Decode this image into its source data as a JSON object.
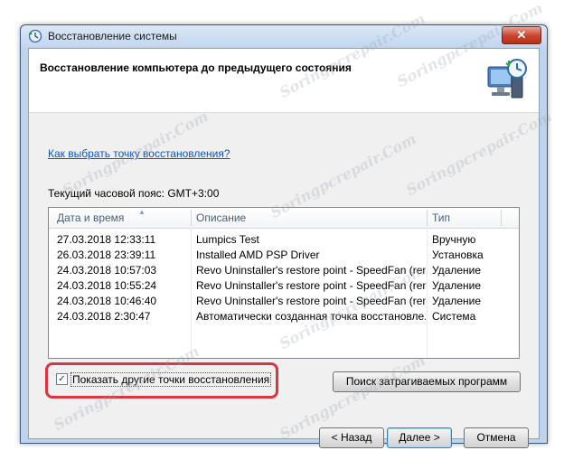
{
  "window": {
    "title": "Восстановление системы",
    "close_label": "✕"
  },
  "header": {
    "title": "Восстановление компьютера до предыдущего состояния"
  },
  "help_link": "Как выбрать точку восстановления?",
  "timezone": "Текущий часовой пояс: GMT+3:00",
  "table": {
    "columns": [
      "Дата и время",
      "Описание",
      "Тип"
    ],
    "rows": [
      {
        "date": "27.03.2018 12:33:11",
        "desc": "Lumpics Test",
        "type": "Вручную"
      },
      {
        "date": "26.03.2018 23:39:11",
        "desc": "Installed AMD PSP Driver",
        "type": "Установка"
      },
      {
        "date": "24.03.2018 10:57:03",
        "desc": "Revo Uninstaller's restore point - SpeedFan (rem...",
        "type": "Удаление"
      },
      {
        "date": "24.03.2018 10:55:24",
        "desc": "Revo Uninstaller's restore point - SpeedFan (rem...",
        "type": "Удаление"
      },
      {
        "date": "24.03.2018 10:46:40",
        "desc": "Revo Uninstaller's restore point - SpeedFan (rem...",
        "type": "Удаление"
      },
      {
        "date": "24.03.2018 2:30:47",
        "desc": "Автоматически созданная точка восстановле...",
        "type": "Система"
      }
    ]
  },
  "show_more": {
    "label": "Показать другие точки восстановления",
    "checked": true,
    "check_glyph": "✓"
  },
  "buttons": {
    "scan": "Поиск затрагиваемых программ",
    "back": "< Назад",
    "next": "Далее >",
    "cancel": "Отмена"
  },
  "watermark": "Soringpcrepair.Com",
  "colors": {
    "highlight_frame": "#d9363e",
    "link": "#0b56c5"
  }
}
